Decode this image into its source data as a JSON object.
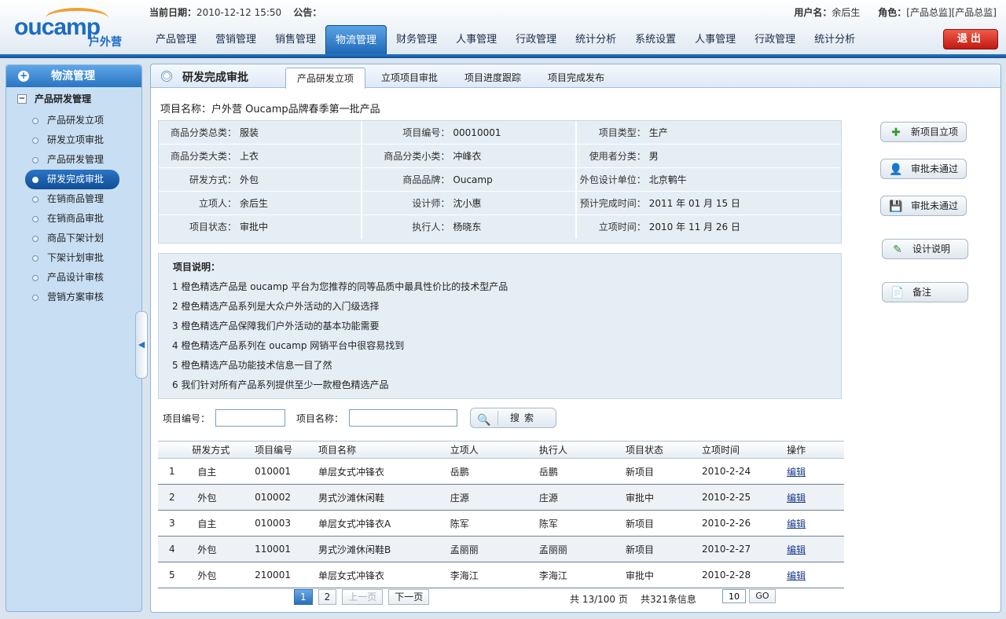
{
  "header": {
    "logo_text": "oucamp",
    "logo_sub": "户外营",
    "date_label": "当前日期：",
    "date_value": "2010-12-12 15:50",
    "notice_label": "公告：",
    "user_label": "用户名：",
    "user_value": "余后生",
    "role_label": "角色：",
    "role_value": "[产品总监][产品总监]",
    "logout_label": "退出"
  },
  "nav": [
    "产品管理",
    "营销管理",
    "销售管理",
    "物流管理",
    "财务管理",
    "人事管理",
    "行政管理",
    "统计分析",
    "系统设置",
    "人事管理",
    "行政管理",
    "统计分析"
  ],
  "nav_active_index": 3,
  "sidebar": {
    "title": "物流管理",
    "group": "产品研发管理",
    "items": [
      "产品研发立项",
      "研发立项审批",
      "产品研发管理",
      "研发完成审批",
      "在销商品管理",
      "在销商品审批",
      "商品下架计划",
      "下架计划审批",
      "产品设计审核",
      "营销方案审核"
    ],
    "active_index": 3
  },
  "main": {
    "title": "研发完成审批",
    "tabs": [
      "产品研发立项",
      "立项项目审批",
      "项目进度跟踪",
      "项目完成发布"
    ],
    "active_tab": 0,
    "project_name_label": "项目名称：",
    "project_name": "户外营 Oucamp品牌春季第一批产品",
    "details": [
      [
        [
          "商品分类总类：",
          "服装"
        ],
        [
          "项目编号：",
          "00010001"
        ],
        [
          "项目类型：",
          "生产"
        ]
      ],
      [
        [
          "商品分类大类：",
          "上衣"
        ],
        [
          "商品分类小类：",
          "冲峰衣"
        ],
        [
          "使用者分类：",
          "男"
        ]
      ],
      [
        [
          "研发方式：",
          "外包"
        ],
        [
          "商品品牌：",
          "Oucamp"
        ],
        [
          "外包设计单位：",
          "北京鹌牛"
        ]
      ],
      [
        [
          "立项人：",
          "余后生"
        ],
        [
          "设计师：",
          "沈小惠"
        ],
        [
          "预计完成时间：",
          "2011 年 01 月 15 日"
        ]
      ],
      [
        [
          "项目状态：",
          "审批中"
        ],
        [
          "执行人：",
          "杨晓东"
        ],
        [
          "立项时间：",
          "2010 年 11 月 26 日"
        ]
      ]
    ],
    "desc_title": "项目说明：",
    "desc_lines": [
      "1 橙色精选产品是 oucamp 平台为您推荐的同等品质中最具性价比的技术型产品",
      "2 橙色精选产品系列是大众户外活动的入门级选择",
      "3 橙色精选产品保障我们户外活动的基本功能需要",
      "4 橙色精选产品系列在 oucamp 网销平台中很容易找到",
      "5 橙色精选产品功能技术信息一目了然",
      "6 我们针对所有产品系列提供至少一款橙色精选产品"
    ]
  },
  "actions": [
    {
      "label": "新项目立项",
      "icon": "plus-icon"
    },
    {
      "label": "审批未通过",
      "icon": "user-icon"
    },
    {
      "label": "审批未通过",
      "icon": "save-icon"
    },
    {
      "label": "设计说明",
      "icon": "pencil-icon"
    },
    {
      "label": "备注",
      "icon": "note-icon"
    }
  ],
  "search": {
    "code_label": "项目编号：",
    "code_value": "",
    "name_label": "项目名称：",
    "name_value": "",
    "button_label": "搜索"
  },
  "table": {
    "headers": [
      "",
      "研发方式",
      "项目编号",
      "项目名称",
      "立项人",
      "执行人",
      "项目状态",
      "立项时间",
      "操作"
    ],
    "rows": [
      [
        "1",
        "自主",
        "010001",
        "单层女式冲锋衣",
        "岳鹏",
        "岳鹏",
        "新项目",
        "2010-2-24",
        "编辑"
      ],
      [
        "2",
        "外包",
        "010002",
        "男式沙滩休闲鞋",
        "庄源",
        "庄源",
        "审批中",
        "2010-2-25",
        "编辑"
      ],
      [
        "3",
        "自主",
        "010003",
        "单层女式冲锋衣A",
        "陈军",
        "陈军",
        "新项目",
        "2010-2-26",
        "编辑"
      ],
      [
        "4",
        "外包",
        "110001",
        "男式沙滩休闲鞋B",
        "孟丽丽",
        "孟丽丽",
        "新项目",
        "2010-2-27",
        "编辑"
      ],
      [
        "5",
        "外包",
        "210001",
        "单层女式冲锋衣",
        "李海江",
        "李海江",
        "审批中",
        "2010-2-28",
        "编辑"
      ]
    ]
  },
  "pager": {
    "pages": [
      "1",
      "2"
    ],
    "prev": "上一页",
    "next": "下一页",
    "page_info": "共 13/100 页",
    "record_info": "共321条信息",
    "goto_value": "10",
    "go_label": "GO"
  }
}
